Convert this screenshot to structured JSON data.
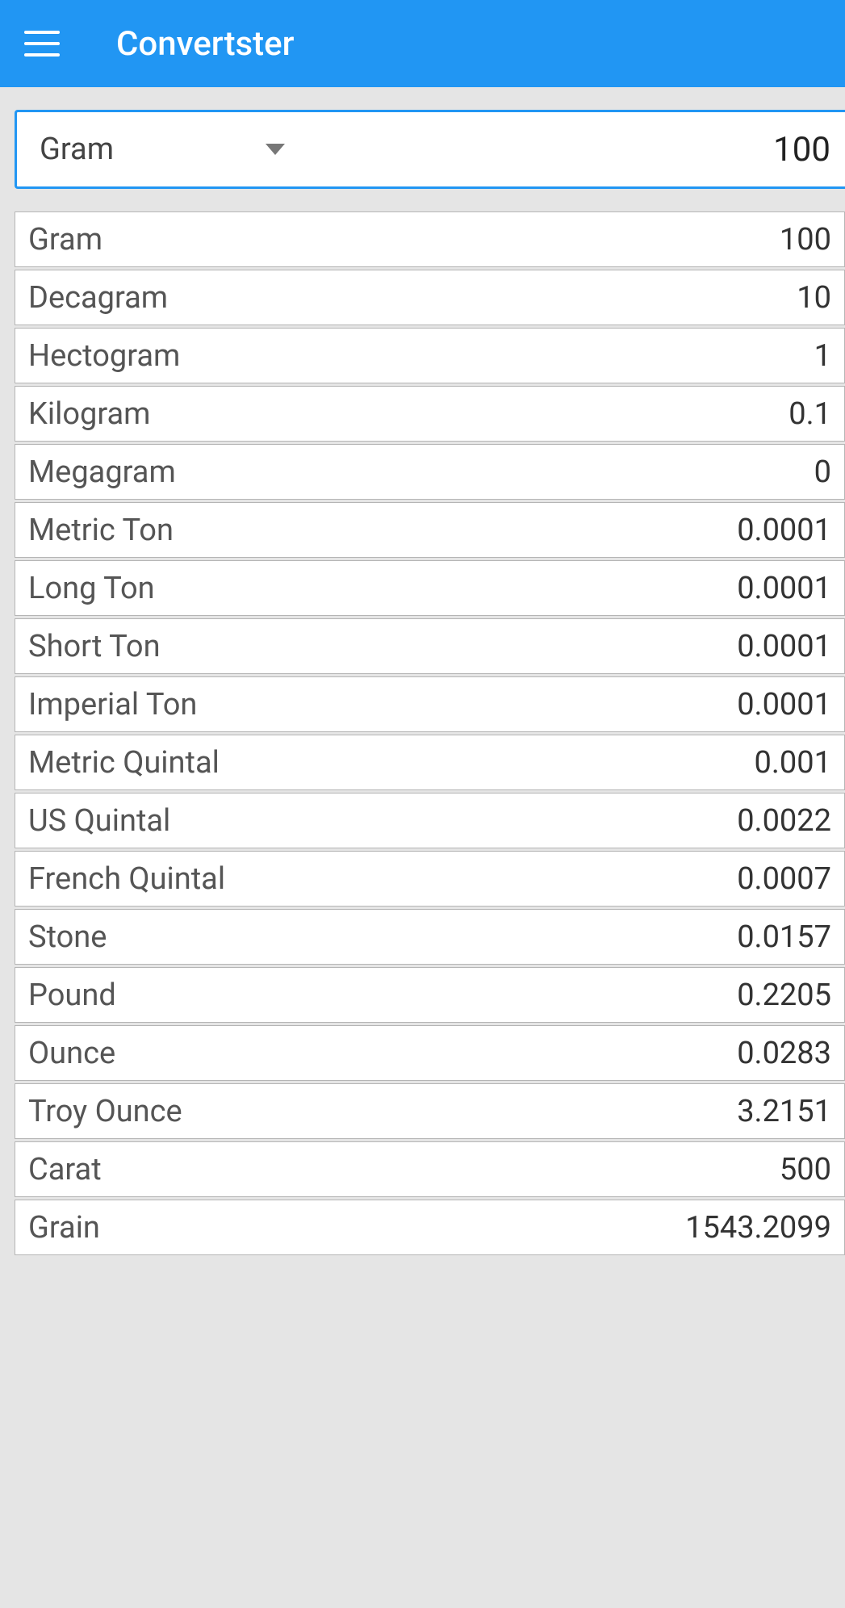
{
  "header": {
    "title": "Convertster"
  },
  "input": {
    "selected_unit": "Gram",
    "value": "100"
  },
  "results": [
    {
      "label": "Gram",
      "value": "100"
    },
    {
      "label": "Decagram",
      "value": "10"
    },
    {
      "label": "Hectogram",
      "value": "1"
    },
    {
      "label": "Kilogram",
      "value": "0.1"
    },
    {
      "label": "Megagram",
      "value": "0"
    },
    {
      "label": "Metric Ton",
      "value": "0.0001"
    },
    {
      "label": "Long Ton",
      "value": "0.0001"
    },
    {
      "label": "Short Ton",
      "value": "0.0001"
    },
    {
      "label": "Imperial Ton",
      "value": "0.0001"
    },
    {
      "label": "Metric Quintal",
      "value": "0.001"
    },
    {
      "label": "US Quintal",
      "value": "0.0022"
    },
    {
      "label": "French Quintal",
      "value": "0.0007"
    },
    {
      "label": "Stone",
      "value": "0.0157"
    },
    {
      "label": "Pound",
      "value": "0.2205"
    },
    {
      "label": "Ounce",
      "value": "0.0283"
    },
    {
      "label": "Troy Ounce",
      "value": "3.2151"
    },
    {
      "label": "Carat",
      "value": "500"
    },
    {
      "label": "Grain",
      "value": "1543.2099"
    }
  ]
}
